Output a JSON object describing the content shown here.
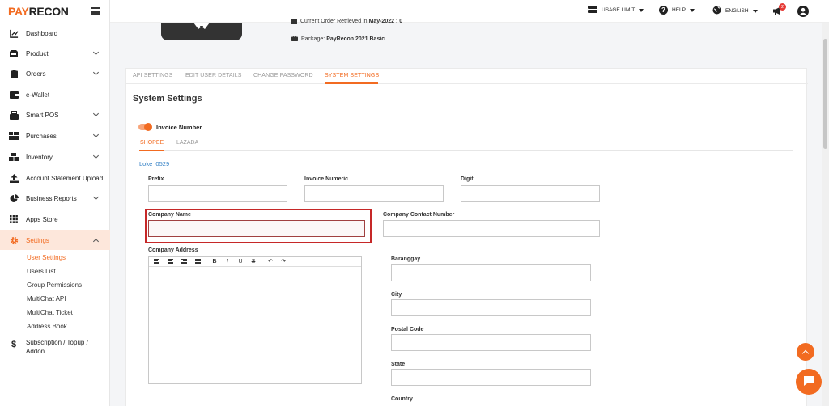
{
  "brand": {
    "pay": "PAY",
    "recon": "RECON"
  },
  "topbar": {
    "usage_limit": "USAGE LIMIT",
    "help": "HELP",
    "language": "ENGLISH",
    "notification_count": "2"
  },
  "sidebar": {
    "items": [
      {
        "label": "Dashboard",
        "icon": "chart-icon"
      },
      {
        "label": "Product",
        "icon": "box-icon"
      },
      {
        "label": "Orders",
        "icon": "clipboard-icon"
      },
      {
        "label": "e-Wallet",
        "icon": "wallet-icon"
      },
      {
        "label": "Smart POS",
        "icon": "pos-icon"
      },
      {
        "label": "Purchases",
        "icon": "cart-icon"
      },
      {
        "label": "Inventory",
        "icon": "boxes-icon"
      },
      {
        "label": "Account Statement Upload",
        "icon": "upload-icon"
      },
      {
        "label": "Business Reports",
        "icon": "pie-chart-icon"
      },
      {
        "label": "Apps Store",
        "icon": "grid-icon"
      },
      {
        "label": "Settings",
        "icon": "gear-icon"
      },
      {
        "label": "Subscription / Topup / Addon",
        "label_line1": "Subscription / Topup /",
        "label_line2": "Addon",
        "icon": "dollar-icon"
      }
    ],
    "settings_sub": [
      "User Settings",
      "Users List",
      "Group Permissions",
      "MultiChat API",
      "MultiChat Ticket",
      "Address Book"
    ]
  },
  "profile": {
    "order_retrieved_label": "Current Order Retrieved in",
    "order_retrieved_value": "May-2022 : 0",
    "package_label": "Package:",
    "package_value": "PayRecon 2021 Basic"
  },
  "tabs": [
    "API SETTINGS",
    "EDIT USER DETAILS",
    "CHANGE PASSWORD",
    "SYSTEM SETTINGS"
  ],
  "section_title": "System Settings",
  "invoice_toggle_label": "Invoice Number",
  "subtabs": [
    "SHOPEE",
    "LAZADA"
  ],
  "shop_name": "Loke_0529",
  "fields": {
    "prefix": "Prefix",
    "invoice_numeric": "Invoice Numeric",
    "digit": "Digit",
    "company_name": "Company Name",
    "company_contact": "Company Contact Number",
    "company_address": "Company Address",
    "barangay": "Baranggay",
    "city": "City",
    "postal_code": "Postal Code",
    "state": "State",
    "country": "Country"
  },
  "colors": {
    "accent": "#f26b21",
    "highlight": "#c62828",
    "link": "#2f7ec4"
  }
}
